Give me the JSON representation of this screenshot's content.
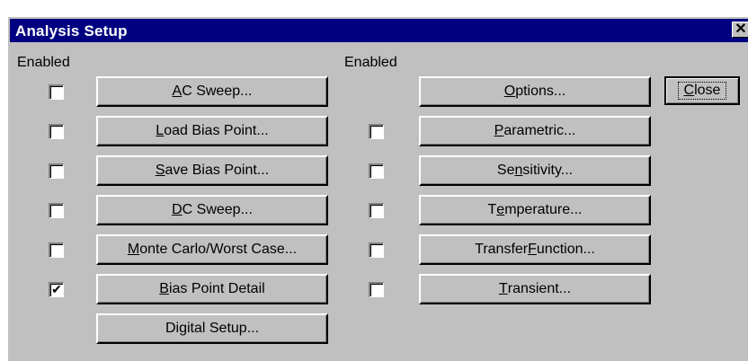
{
  "window": {
    "title": "Analysis Setup",
    "close_glyph": "✕"
  },
  "column_headers": {
    "left": "Enabled",
    "right": "Enabled"
  },
  "left_buttons": [
    {
      "pre": "",
      "key": "A",
      "post": "C Sweep...",
      "checked": false,
      "has_checkbox": true
    },
    {
      "pre": "",
      "key": "L",
      "post": "oad Bias Point...",
      "checked": false,
      "has_checkbox": true
    },
    {
      "pre": "",
      "key": "S",
      "post": "ave Bias Point...",
      "checked": false,
      "has_checkbox": true
    },
    {
      "pre": "",
      "key": "D",
      "post": "C Sweep...",
      "checked": false,
      "has_checkbox": true
    },
    {
      "pre": "",
      "key": "M",
      "post": "onte Carlo/Worst Case...",
      "checked": false,
      "has_checkbox": true
    },
    {
      "pre": "",
      "key": "B",
      "post": "ias Point Detail",
      "checked": true,
      "has_checkbox": true
    },
    {
      "pre": "Digital Setup...",
      "key": "",
      "post": "",
      "checked": false,
      "has_checkbox": false
    }
  ],
  "right_buttons": [
    {
      "pre": "",
      "key": "O",
      "post": "ptions...",
      "checked": false,
      "has_checkbox": false
    },
    {
      "pre": "",
      "key": "P",
      "post": "arametric...",
      "checked": false,
      "has_checkbox": true
    },
    {
      "pre": "Se",
      "key": "n",
      "post": "sitivity...",
      "checked": false,
      "has_checkbox": true
    },
    {
      "pre": "T",
      "key": "e",
      "post": "mperature...",
      "checked": false,
      "has_checkbox": true
    },
    {
      "pre": "Transfer ",
      "key": "F",
      "post": "unction...",
      "checked": false,
      "has_checkbox": true
    },
    {
      "pre": "",
      "key": "T",
      "post": "ransient...",
      "checked": false,
      "has_checkbox": true
    }
  ],
  "close_button": {
    "pre": "",
    "key": "C",
    "post": "lose"
  },
  "check_glyph": "✔"
}
